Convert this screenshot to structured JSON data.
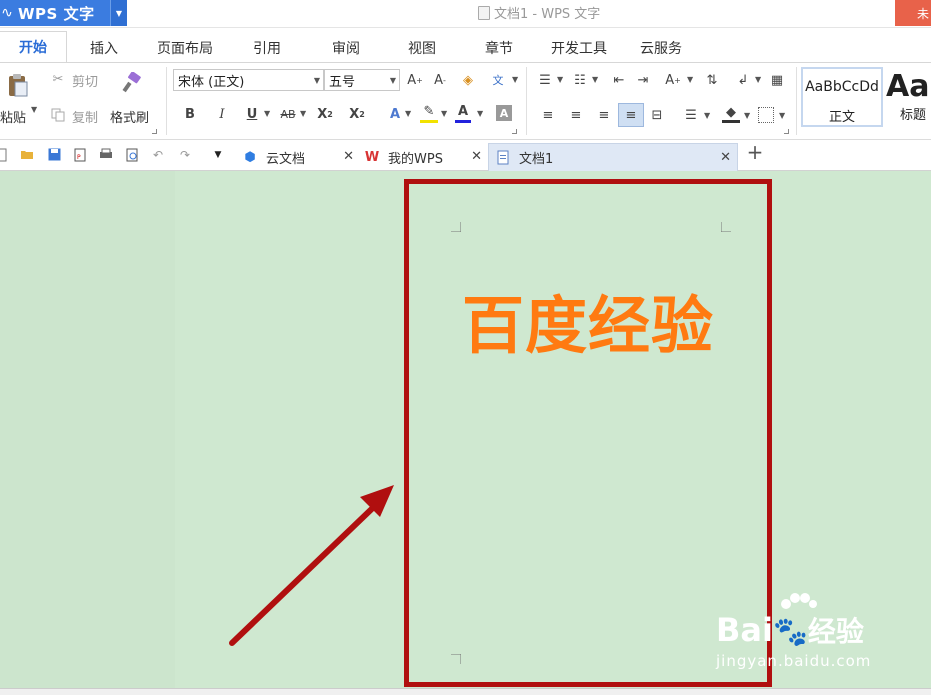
{
  "app": {
    "menu_label": "WPS 文字",
    "window_title": "文档1 - WPS 文字",
    "login_label": "未"
  },
  "ribbon_tabs": [
    "开始",
    "插入",
    "页面布局",
    "引用",
    "审阅",
    "视图",
    "章节",
    "开发工具",
    "云服务"
  ],
  "clipboard": {
    "paste": "粘贴",
    "cut": "剪切",
    "copy": "复制",
    "format_painter": "格式刷"
  },
  "font": {
    "name": "宋体 (正文)",
    "size": "五号"
  },
  "styles": [
    {
      "sample": "AaBbCcDd",
      "name": "正文"
    },
    {
      "sample": "AaI",
      "name": "标题"
    }
  ],
  "doc_tabs": [
    {
      "label": "云文档"
    },
    {
      "label": "我的WPS"
    },
    {
      "label": "文档1"
    }
  ],
  "document": {
    "heading": "百度经验",
    "heading_color": "#ff7a11",
    "highlight_color": "#b00f0f"
  },
  "watermark": {
    "brand": "Bai",
    "brand_tail": "经验",
    "url": "jingyan.baidu.com"
  }
}
